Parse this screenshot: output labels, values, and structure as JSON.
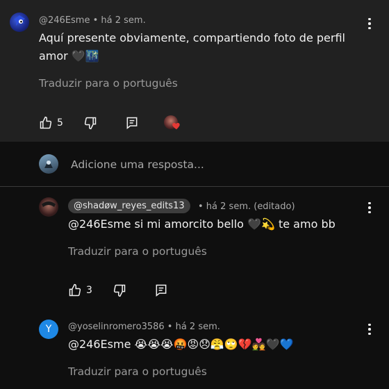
{
  "top_comment": {
    "author": "@246Esme",
    "time": "• há 2 sem.",
    "line1": "Aquí presente obviamente, compartiendo foto de perfil",
    "line2": "amor 🖤🌃",
    "translate": "Traduzir para o português",
    "likes": "5"
  },
  "reply_box": {
    "placeholder": "Adicione uma resposta..."
  },
  "reply1": {
    "mention": "@shadøw_reyes_edits13",
    "meta": "• há 2 sem. (editado)",
    "text": "@246Esme si mi amorcito bello 🖤💫 te amo bb",
    "translate": "Traduzir para o português",
    "likes": "3"
  },
  "reply2": {
    "avatar_letter": "Y",
    "author": "@yoselinromero3586",
    "time": "• há 2 sem.",
    "text": "@246Esme 😭😭😭🤬😡😞😤🙄💔💑🖤💙",
    "translate": "Traduzir para o português"
  },
  "colors": {
    "top_bg": "#212121",
    "page_bg": "#0f0f0f",
    "avatar_y": "#1e88e5",
    "heart_badge": "#e53935"
  }
}
